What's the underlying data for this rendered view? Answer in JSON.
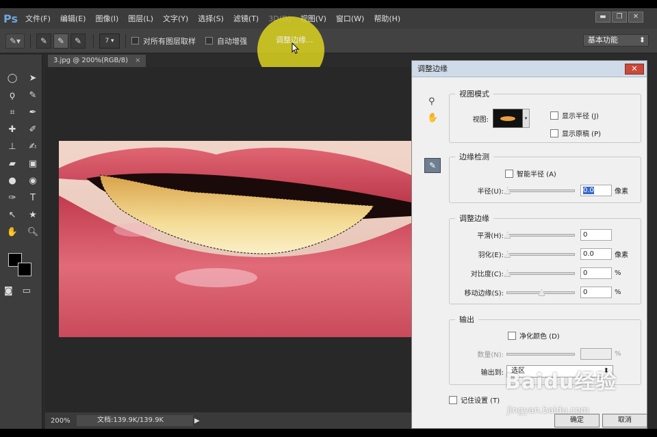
{
  "app": {
    "logo": "Ps"
  },
  "menu": [
    "文件(F)",
    "编辑(E)",
    "图像(I)",
    "图层(L)",
    "文字(Y)",
    "选择(S)",
    "滤镜(T)",
    "3D(D)",
    "视图(V)",
    "窗口(W)",
    "帮助(H)"
  ],
  "window_controls": {
    "minimize": "▬",
    "restore": "❐",
    "close": "✕"
  },
  "options": {
    "brush_size": "7",
    "sample_all_layers": "对所有图层取样",
    "auto_enhance": "自动增强",
    "refine_edge": "调整边缘...",
    "workspace": "基本功能"
  },
  "document": {
    "tab": "3.jpg @ 200%(RGB/8)",
    "tab_close": "×",
    "zoom": "200%",
    "doc_size": "文档:139.9K/139.9K"
  },
  "dialog": {
    "title": "调整边缘",
    "close": "✕",
    "view_mode": {
      "legend": "视图模式",
      "view_label": "视图:",
      "show_radius": "显示半径 (J)",
      "show_original": "显示原稿 (P)"
    },
    "edge_detection": {
      "legend": "边缘检测",
      "smart_radius": "智能半径 (A)",
      "radius_label": "半径(U):",
      "radius_value": "0.0",
      "radius_unit": "像素"
    },
    "adjust_edge": {
      "legend": "调整边缘",
      "smooth_label": "平滑(H):",
      "smooth_value": "0",
      "feather_label": "羽化(E):",
      "feather_value": "0.0",
      "feather_unit": "像素",
      "contrast_label": "对比度(C):",
      "contrast_value": "0",
      "contrast_unit": "%",
      "shift_label": "移动边缘(S):",
      "shift_value": "0",
      "shift_unit": "%"
    },
    "output": {
      "legend": "输出",
      "decontaminate": "净化颜色 (D)",
      "amount_label": "数量(N):",
      "amount_unit": "%",
      "output_to_label": "输出到:",
      "output_to_value": "选区"
    },
    "remember": "记住设置 (T)",
    "ok": "确定",
    "cancel": "取消"
  },
  "watermark": {
    "brand": "Baidu经验",
    "url": "jingyan.baidu.com"
  },
  "colors": {
    "highlight": "#dcd21e",
    "lips": "#c9485a",
    "teeth": "#eac66a"
  }
}
